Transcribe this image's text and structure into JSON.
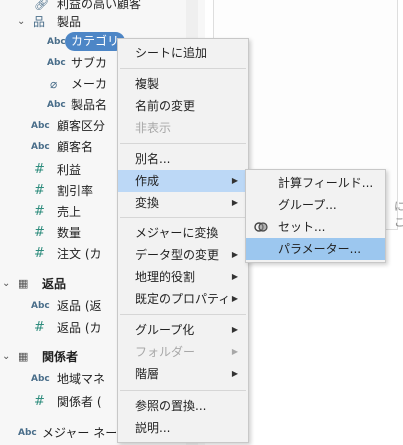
{
  "data_pane": {
    "rows": [
      {
        "icon_text": "",
        "icon": "clip-icon",
        "label": "利益の高い顧客"
      },
      {
        "icon_text": "品",
        "icon": "hierarchy-icon",
        "label": "製品",
        "chevron": "⌄"
      },
      {
        "icon_text": "Abc",
        "icon": "string-type-icon",
        "label": "カテゴリ"
      },
      {
        "icon_text": "Abc",
        "icon": "string-type-icon",
        "label": "サブカ"
      },
      {
        "icon_text": "",
        "icon": "clip-icon",
        "label": "メーカ"
      },
      {
        "icon_text": "Abc",
        "icon": "string-type-icon",
        "label": "製品名"
      },
      {
        "icon_text": "Abc",
        "icon": "string-type-icon",
        "label": "顧客区分"
      },
      {
        "icon_text": "Abc",
        "icon": "string-type-icon",
        "label": "顧客名"
      },
      {
        "icon_text": "#",
        "icon": "number-type-icon",
        "label": "利益"
      },
      {
        "icon_text": "#",
        "icon": "number-type-icon",
        "label": "割引率"
      },
      {
        "icon_text": "#",
        "icon": "number-type-icon",
        "label": "売上"
      },
      {
        "icon_text": "#",
        "icon": "number-type-icon",
        "label": "数量"
      },
      {
        "icon_text": "#",
        "icon": "number-type-icon",
        "label": "注文 (カ"
      },
      {
        "icon_text": "▦",
        "icon": "table-icon",
        "label": "返品",
        "chevron": "⌄",
        "bold": true
      },
      {
        "icon_text": "Abc",
        "icon": "string-type-icon",
        "label": "返品 (返"
      },
      {
        "icon_text": "#",
        "icon": "number-type-icon",
        "label": "返品 (カ"
      },
      {
        "icon_text": "▦",
        "icon": "table-icon",
        "label": "関係者",
        "chevron": "⌄",
        "bold": true
      },
      {
        "icon_text": "Abc",
        "icon": "string-type-icon",
        "label": "地域マネ"
      },
      {
        "icon_text": "#",
        "icon": "number-type-icon",
        "label": "関係者 ("
      },
      {
        "icon_text": "Abc",
        "icon": "string-type-icon",
        "label": "メジャー ネー"
      }
    ]
  },
  "right_text": "にこ",
  "context_menu": {
    "items": [
      {
        "label": "シートに追加"
      },
      {
        "label": "複製"
      },
      {
        "label": "名前の変更"
      },
      {
        "label": "非表示",
        "disabled": true
      },
      {
        "label": "別名..."
      },
      {
        "label": "作成",
        "submenu": true,
        "highlighted": true
      },
      {
        "label": "変換",
        "submenu": true
      },
      {
        "label": "メジャーに変換"
      },
      {
        "label": "データ型の変更",
        "submenu": true
      },
      {
        "label": "地理的役割",
        "submenu": true
      },
      {
        "label": "既定のプロパティ",
        "submenu": true
      },
      {
        "label": "グループ化",
        "submenu": true
      },
      {
        "label": "フォルダー",
        "submenu": true,
        "disabled": true
      },
      {
        "label": "階層",
        "submenu": true
      },
      {
        "label": "参照の置換..."
      },
      {
        "label": "説明..."
      }
    ],
    "submenu_arrow": "▶"
  },
  "create_submenu": {
    "items": [
      {
        "label": "計算フィールド..."
      },
      {
        "label": "グループ..."
      },
      {
        "label": "セット...",
        "icon": "set-icon"
      },
      {
        "label": "パラメーター...",
        "highlighted": true
      }
    ]
  },
  "colors": {
    "pill": "#4d86c6",
    "menu_highlight": "#bcd8f6",
    "submenu_highlight": "#9cc7ef",
    "menu_background": "#f2f2f2",
    "number_icon": "#2f8d7e",
    "string_icon": "#4a6e8a"
  }
}
